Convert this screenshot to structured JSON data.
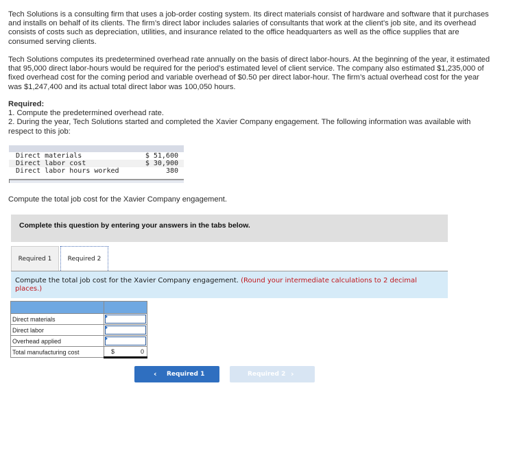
{
  "intro": {
    "paragraph1": "Tech Solutions is a consulting firm that uses a job-order costing system. Its direct materials consist of hardware and software that it purchases and installs on behalf of its clients. The firm’s direct labor includes salaries of consultants that work at the client’s job site, and its overhead consists of costs such as depreciation, utilities, and insurance related to the office headquarters as well as the office supplies that are consumed serving clients.",
    "paragraph2": "Tech Solutions computes its predetermined overhead rate annually on the basis of direct labor-hours. At the beginning of the year, it estimated that 95,000 direct labor-hours would be required for the period’s estimated level of client service. The company also estimated $1,235,000 of fixed overhead cost for the coming period and variable overhead of $0.50 per direct labor-hour. The firm’s actual overhead cost for the year was $1,247,400 and its actual total direct labor was 100,050 hours."
  },
  "required": {
    "heading": "Required:",
    "item1": "1. Compute the predetermined overhead rate.",
    "item2": "2. During the year, Tech Solutions started and completed the Xavier Company engagement. The following information was available with respect to this job:"
  },
  "given_table": {
    "rows": [
      {
        "label": "Direct materials",
        "value": "$ 51,600"
      },
      {
        "label": "Direct labor cost",
        "value": "$ 30,900"
      },
      {
        "label": "Direct labor hours worked",
        "value": "380"
      }
    ]
  },
  "compute_prompt": "Compute the total job cost for the Xavier Company engagement.",
  "banner": "Complete this question by entering your answers in the tabs below.",
  "tabs": [
    {
      "label": "Required 1",
      "active": false
    },
    {
      "label": "Required 2",
      "active": true
    }
  ],
  "instruction": {
    "text": "Compute the total job cost for the Xavier Company engagement.",
    "note": "(Round your intermediate calculations to 2 decimal places.)"
  },
  "answer_table": {
    "rows": [
      {
        "label": "Direct materials",
        "value": ""
      },
      {
        "label": "Direct labor",
        "value": ""
      },
      {
        "label": "Overhead applied",
        "value": ""
      }
    ],
    "total": {
      "label": "Total manufacturing cost",
      "currency": "$",
      "value": "0"
    }
  },
  "nav": {
    "prev_label": "Required 1",
    "next_label": "Required 2",
    "prev_icon": "chevron-left",
    "next_icon": "chevron-right"
  },
  "colors": {
    "accent": "#2f6fc0",
    "note_red": "#c0161b",
    "instruction_bg": "#d6ebf8",
    "table_header": "#6fa8e2"
  }
}
